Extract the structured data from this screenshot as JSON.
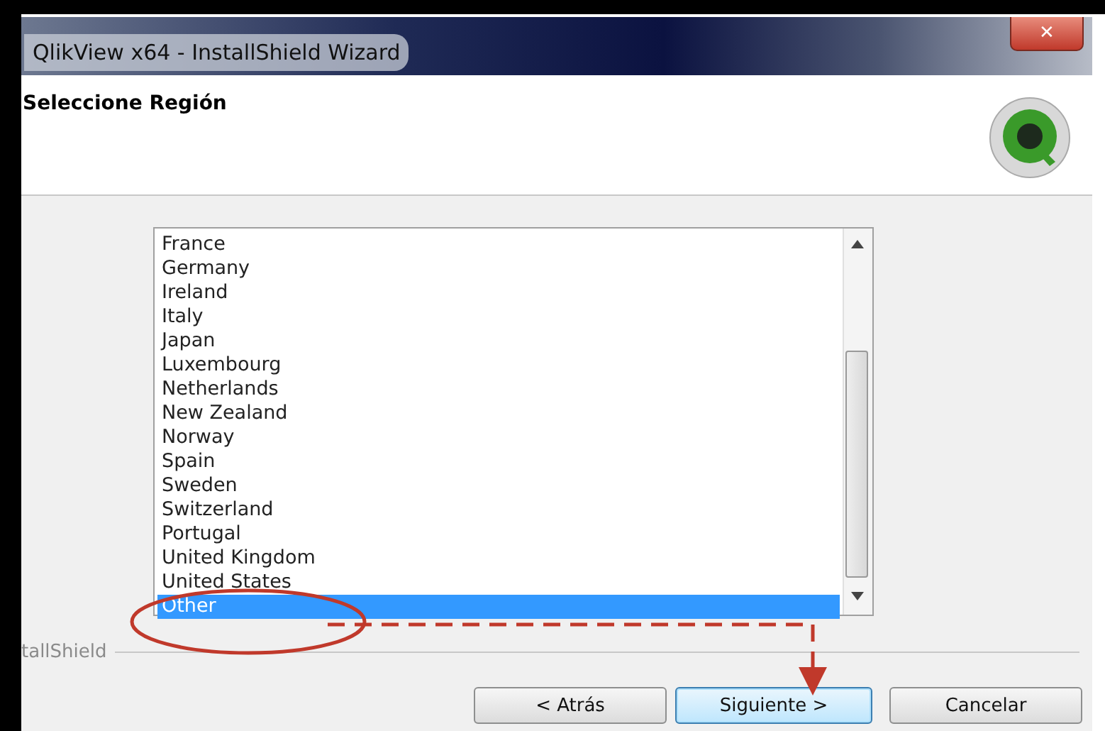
{
  "window": {
    "title": "QlikView x64 - InstallShield Wizard",
    "close_symbol": "✕"
  },
  "header": {
    "title": "Seleccione Región"
  },
  "region_list": {
    "items": [
      {
        "label": "France",
        "selected": false
      },
      {
        "label": "Germany",
        "selected": false
      },
      {
        "label": "Ireland",
        "selected": false
      },
      {
        "label": "Italy",
        "selected": false
      },
      {
        "label": "Japan",
        "selected": false
      },
      {
        "label": "Luxembourg",
        "selected": false
      },
      {
        "label": "Netherlands",
        "selected": false
      },
      {
        "label": "New Zealand",
        "selected": false
      },
      {
        "label": "Norway",
        "selected": false
      },
      {
        "label": "Spain",
        "selected": false
      },
      {
        "label": "Sweden",
        "selected": false
      },
      {
        "label": "Switzerland",
        "selected": false
      },
      {
        "label": "Portugal",
        "selected": false
      },
      {
        "label": "United Kingdom",
        "selected": false
      },
      {
        "label": "United States",
        "selected": false
      },
      {
        "label": "Other",
        "selected": true
      }
    ]
  },
  "footer": {
    "brand": "tallShield"
  },
  "buttons": [
    {
      "label": "< Atrás",
      "kind": "back"
    },
    {
      "label": "Siguiente >",
      "kind": "next"
    },
    {
      "label": "Cancelar",
      "kind": "cancel"
    }
  ]
}
